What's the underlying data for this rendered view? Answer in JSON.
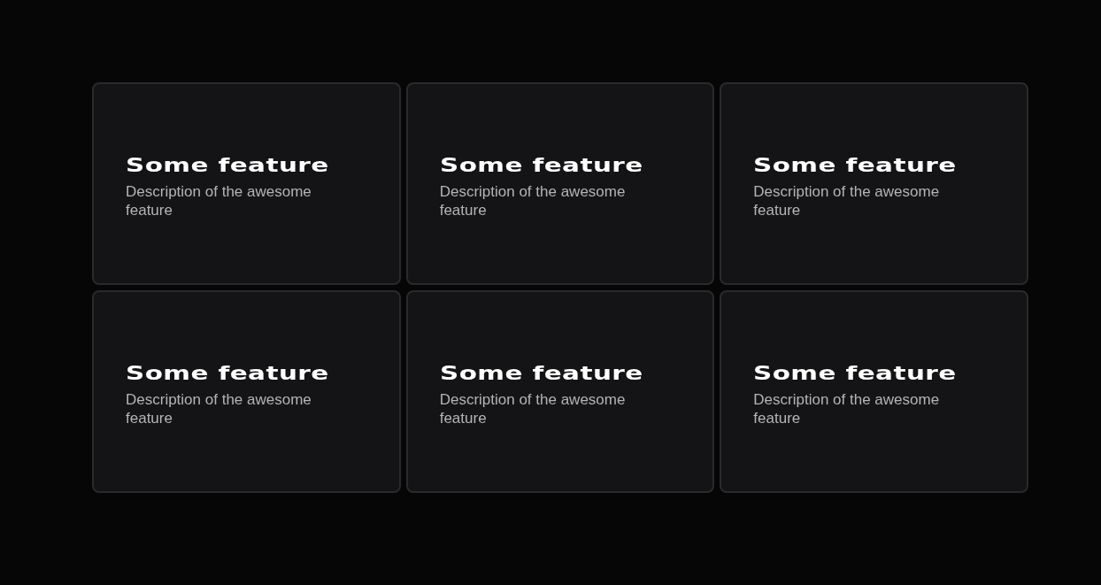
{
  "features": [
    {
      "title": "Some feature",
      "description": "Description of the awesome feature"
    },
    {
      "title": "Some feature",
      "description": "Description of the awesome feature"
    },
    {
      "title": "Some feature",
      "description": "Description of the awesome feature"
    },
    {
      "title": "Some feature",
      "description": "Description of the awesome feature"
    },
    {
      "title": "Some feature",
      "description": "Description of the awesome feature"
    },
    {
      "title": "Some feature",
      "description": "Description of the awesome feature"
    }
  ]
}
